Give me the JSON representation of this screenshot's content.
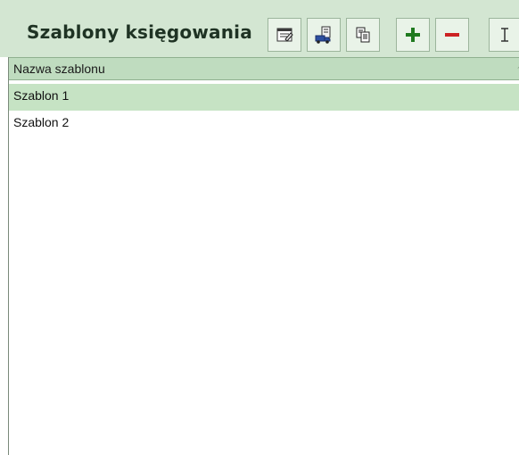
{
  "header": {
    "title": "Szablony księgowania"
  },
  "toolbar": {
    "buttons": [
      {
        "icon": "properties-icon"
      },
      {
        "icon": "book-truck-icon"
      },
      {
        "icon": "copy-icon"
      },
      {
        "icon": "add-icon",
        "color": "#1f7a1f"
      },
      {
        "icon": "remove-icon",
        "color": "#cc2222"
      },
      {
        "icon": "text-cursor-icon"
      }
    ]
  },
  "table": {
    "column_header": "Nazwa szablonu",
    "sort_indicator": "^",
    "rows": [
      {
        "label": "Szablon 1",
        "selected": true
      },
      {
        "label": "Szablon 2",
        "selected": false
      }
    ]
  },
  "colors": {
    "header_bg": "#d3e6d2",
    "column_header_bg": "#bfdcbf",
    "selected_row_bg": "#c6e3c4"
  }
}
